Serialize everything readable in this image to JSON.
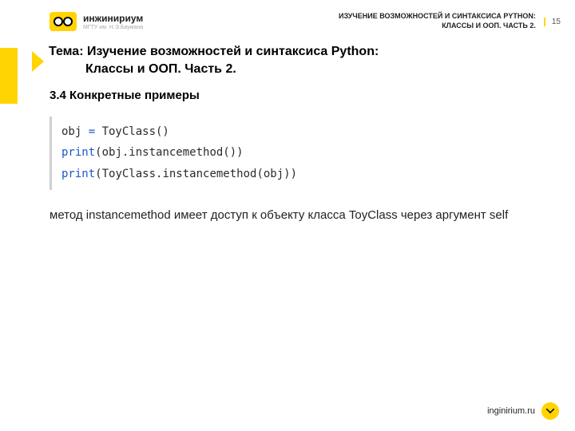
{
  "logo": {
    "title": "инжинириум",
    "sub": "МГТУ им. Н.Э.Баумана"
  },
  "header": {
    "line1": "ИЗУЧЕНИЕ ВОЗМОЖНОСТЕЙ И СИНТАКСИСА PYTHON:",
    "line2": "КЛАССЫ И ООП. ЧАСТЬ 2.",
    "page": "15"
  },
  "topic": {
    "label": "Тема:",
    "line1": "Изучение возможностей и синтаксиса Python:",
    "line2": "Классы и ООП. Часть 2."
  },
  "section": "3.4 Конкретные примеры",
  "code": {
    "l1a": "obj ",
    "l1b": "= ",
    "l1c": "ToyClass()",
    "l2a": "print",
    "l2b": "(obj.instancemethod())",
    "l3a": "print",
    "l3b": "(ToyClass.instancemethod(obj))"
  },
  "body": "метод instancemethod имеет доступ к объекту класса ToyClass через аргумент self",
  "footer": "inginirium.ru"
}
